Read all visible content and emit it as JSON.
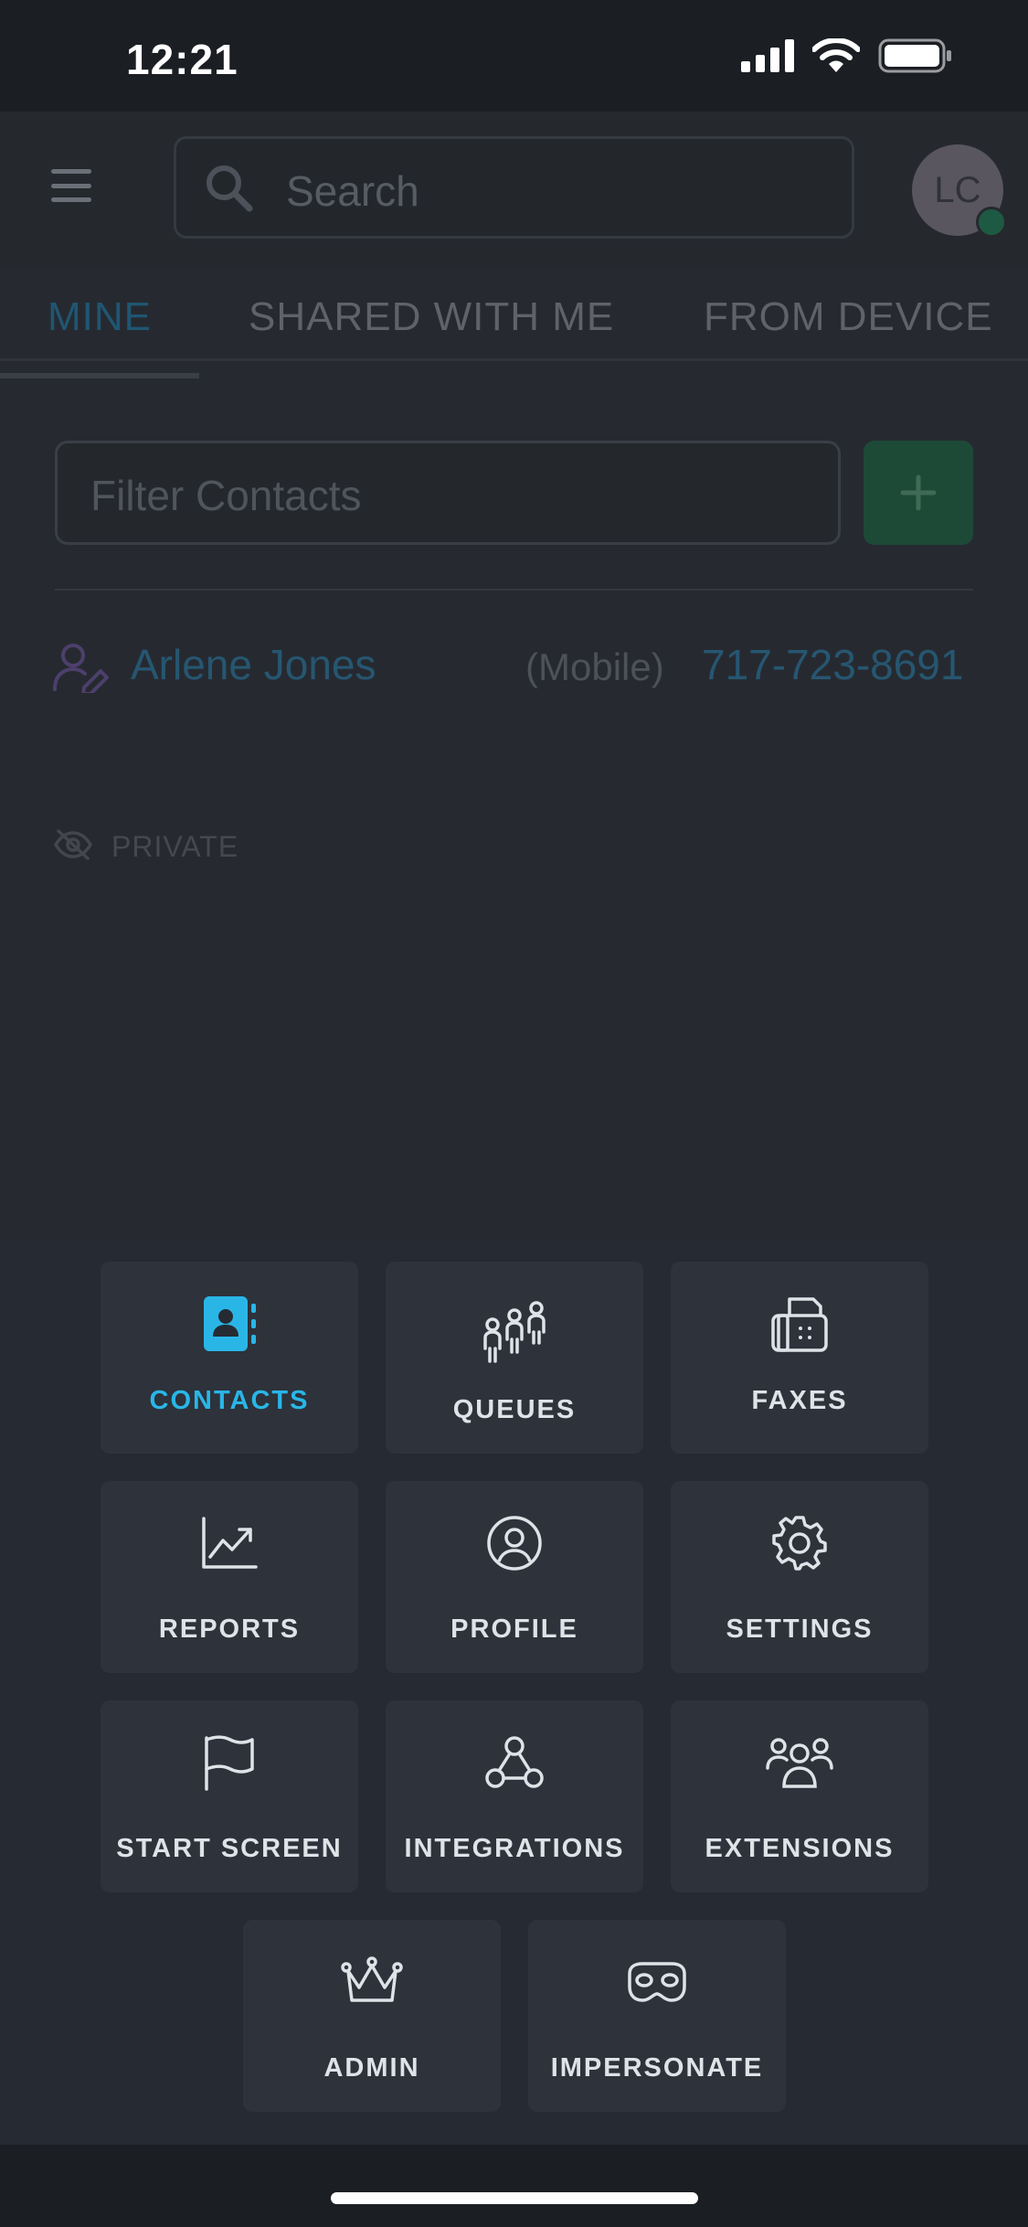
{
  "status_bar": {
    "time": "12:21"
  },
  "header": {
    "search_placeholder": "Search",
    "avatar_initials": "LC"
  },
  "tabs": [
    {
      "label": "MINE",
      "active": true
    },
    {
      "label": "SHARED WITH ME",
      "active": false
    },
    {
      "label": "FROM DEVICE",
      "active": false
    }
  ],
  "filter": {
    "placeholder": "Filter Contacts",
    "add_label": "+"
  },
  "contacts": [
    {
      "name": "Arlene Jones",
      "phone_type": "(Mobile)",
      "phone": "717-723-8691",
      "visibility": "PRIVATE"
    }
  ],
  "menu": {
    "items": [
      {
        "label": "CONTACTS",
        "icon": "contacts-book-icon",
        "active": true
      },
      {
        "label": "QUEUES",
        "icon": "queue-people-icon",
        "active": false
      },
      {
        "label": "FAXES",
        "icon": "fax-icon",
        "active": false
      },
      {
        "label": "REPORTS",
        "icon": "chart-trend-icon",
        "active": false
      },
      {
        "label": "PROFILE",
        "icon": "user-circle-icon",
        "active": false
      },
      {
        "label": "SETTINGS",
        "icon": "gear-icon",
        "active": false
      },
      {
        "label": "START SCREEN",
        "icon": "flag-icon",
        "active": false
      },
      {
        "label": "INTEGRATIONS",
        "icon": "webhook-icon",
        "active": false
      },
      {
        "label": "EXTENSIONS",
        "icon": "users-group-icon",
        "active": false
      },
      {
        "label": "ADMIN",
        "icon": "crown-icon",
        "active": false
      },
      {
        "label": "IMPERSONATE",
        "icon": "mask-icon",
        "active": false
      }
    ]
  },
  "colors": {
    "accent": "#29b6e7",
    "add_button": "#1d4a37",
    "link": "#265671"
  }
}
